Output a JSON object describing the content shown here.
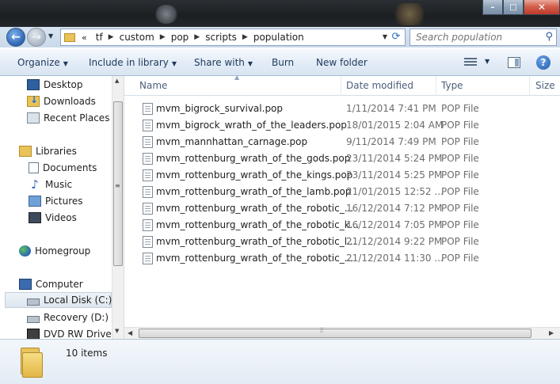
{
  "window": {
    "minimize_glyph": "–",
    "maximize_glyph": "□",
    "close_glyph": "✕"
  },
  "address": {
    "overflow": "«",
    "crumbs": [
      "tf",
      "custom",
      "pop",
      "scripts",
      "population"
    ]
  },
  "search": {
    "placeholder": "Search population"
  },
  "toolbar": {
    "organize": "Organize",
    "include_in_library": "Include in library",
    "share_with": "Share with",
    "burn": "Burn",
    "new_folder": "New folder",
    "help": "?"
  },
  "nav": {
    "desktop": "Desktop",
    "downloads": "Downloads",
    "recent_places": "Recent Places",
    "libraries": "Libraries",
    "documents": "Documents",
    "music": "Music",
    "pictures": "Pictures",
    "videos": "Videos",
    "homegroup": "Homegroup",
    "computer": "Computer",
    "local_disk": "Local Disk (C:)",
    "recovery": "Recovery (D:)",
    "dvd": "DVD RW Drive (E"
  },
  "columns": {
    "name": "Name",
    "date_modified": "Date modified",
    "type": "Type",
    "size": "Size"
  },
  "files": [
    {
      "name": "mvm_bigrock_survival.pop",
      "date": "1/11/2014 7:41 PM",
      "type": "POP File"
    },
    {
      "name": "mvm_bigrock_wrath_of_the_leaders.pop",
      "date": "18/01/2015 2:04 AM",
      "type": "POP File"
    },
    {
      "name": "mvm_mannhattan_carnage.pop",
      "date": "9/11/2014 7:49 PM",
      "type": "POP File"
    },
    {
      "name": "mvm_rottenburg_wrath_of_the_gods.pop",
      "date": "23/11/2014 5:24 PM",
      "type": "POP File"
    },
    {
      "name": "mvm_rottenburg_wrath_of_the_kings.pop",
      "date": "23/11/2014 5:25 PM",
      "type": "POP File"
    },
    {
      "name": "mvm_rottenburg_wrath_of_the_lamb.pop",
      "date": "21/01/2015 12:52 ...",
      "type": "POP File"
    },
    {
      "name": "mvm_rottenburg_wrath_of_the_robotic_...",
      "date": "16/12/2014 7:12 PM",
      "type": "POP File"
    },
    {
      "name": "mvm_rottenburg_wrath_of_the_robotic_k...",
      "date": "16/12/2014 7:05 PM",
      "type": "POP File"
    },
    {
      "name": "mvm_rottenburg_wrath_of_the_robotic_l...",
      "date": "21/12/2014 9:22 PM",
      "type": "POP File"
    },
    {
      "name": "mvm_rottenburg_wrath_of_the_robotic_...",
      "date": "21/12/2014 11:30 ...",
      "type": "POP File"
    }
  ],
  "status": {
    "item_count": "10 items"
  }
}
